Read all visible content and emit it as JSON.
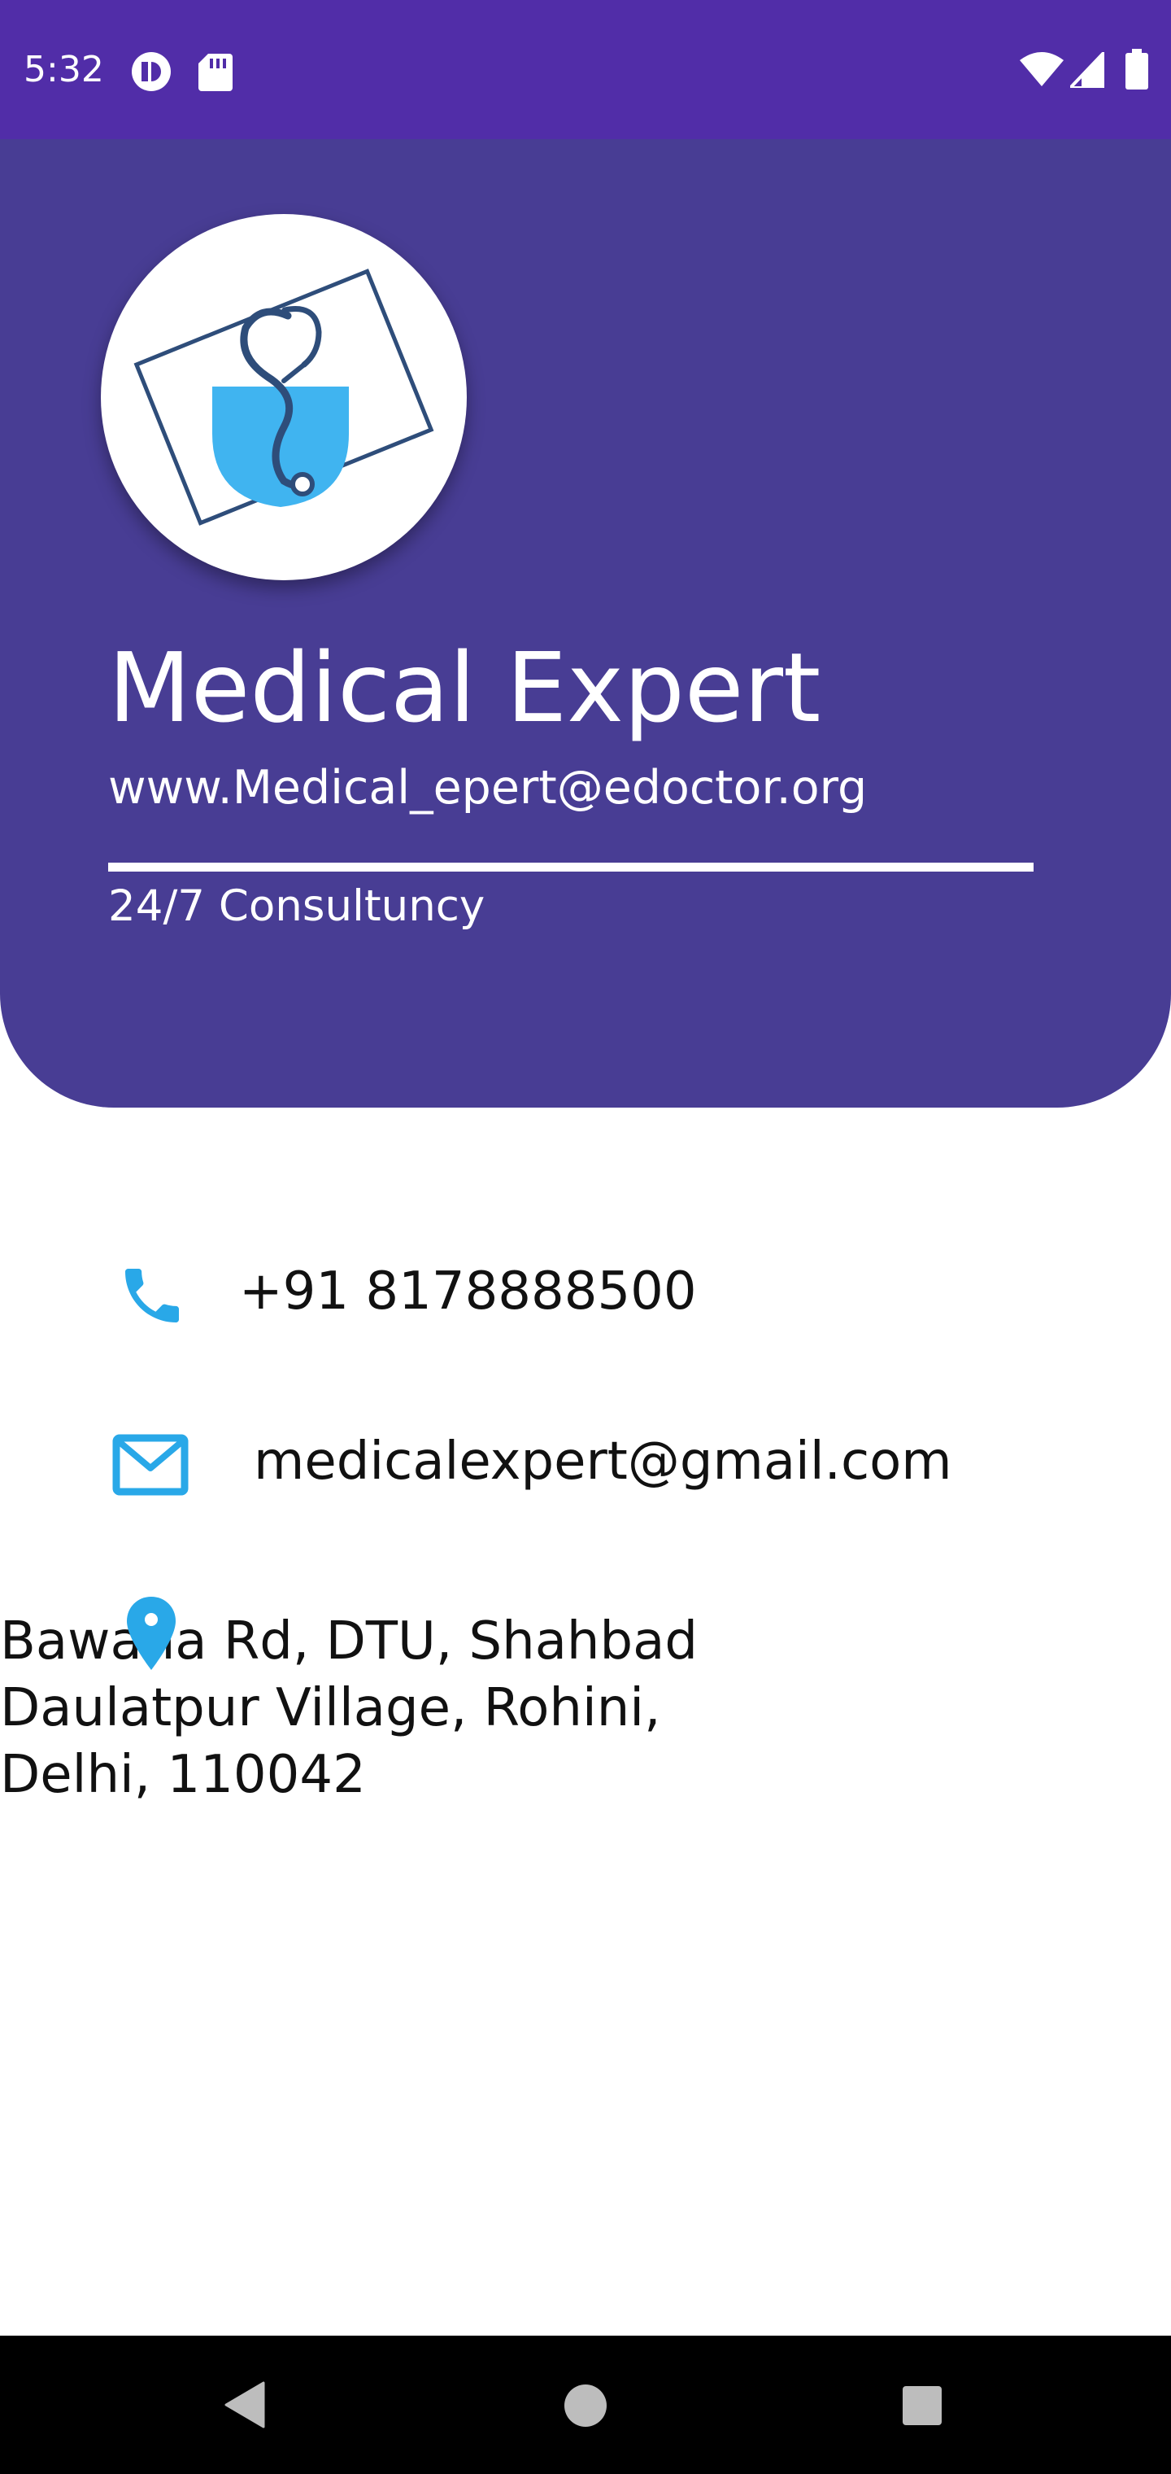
{
  "status_bar": {
    "time": "5:32",
    "icons": [
      "privacy-dot-icon",
      "sd-card-icon",
      "wifi-icon",
      "signal-icon",
      "battery-icon"
    ],
    "background_color": "#512da8"
  },
  "header": {
    "logo_icon": "stethoscope-pocket-logo",
    "title": "Medical Expert",
    "website": "www.Medical_epert@edoctor.org",
    "tagline": "24/7 Consultuncy",
    "background_color": "#483d94"
  },
  "contacts": {
    "phone": {
      "icon": "phone-icon",
      "value": "+91 8178888500"
    },
    "email": {
      "icon": "mail-icon",
      "value": "medicalexpert@gmail.com"
    },
    "address": {
      "icon": "location-pin-icon",
      "lines": [
        "Bawana Rd, DTU, Shahbad",
        "Daulatpur Village, Rohini,",
        "Delhi, 110042"
      ]
    },
    "accent_color": "#29a8e8"
  },
  "nav_bar": {
    "buttons": [
      "back-icon",
      "home-icon",
      "recents-icon"
    ]
  }
}
